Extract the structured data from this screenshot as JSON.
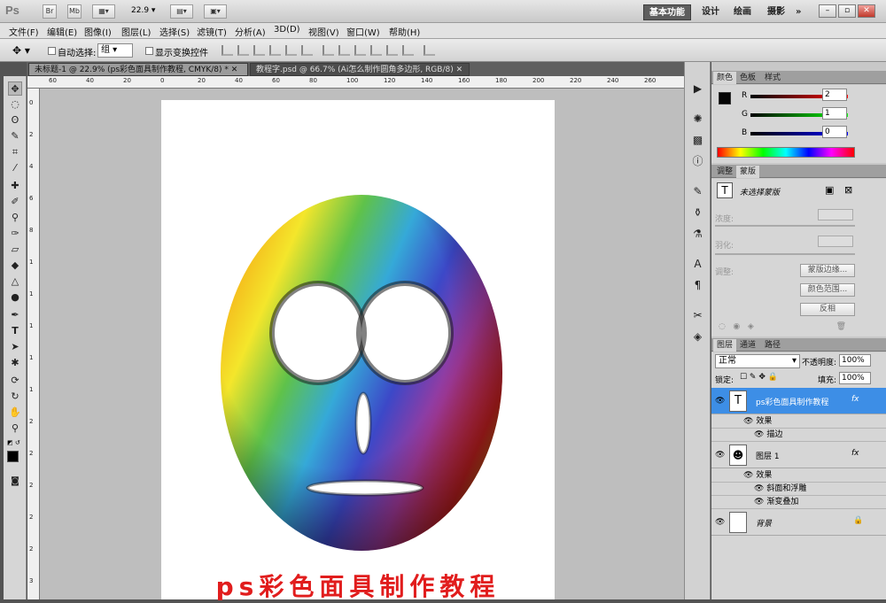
{
  "app": {
    "logo": "Ps",
    "zoom": "22.9",
    "br": "Br",
    "mb": "Mb"
  },
  "workspaces": [
    "基本功能",
    "设计",
    "绘画",
    "摄影",
    "»"
  ],
  "menus": [
    "文件(F)",
    "编辑(E)",
    "图像(I)",
    "图层(L)",
    "选择(S)",
    "滤镜(T)",
    "分析(A)",
    "3D(D)",
    "视图(V)",
    "窗口(W)",
    "帮助(H)"
  ],
  "options": {
    "auto_select": "自动选择:",
    "group_value": "组",
    "show_transform": "显示变换控件"
  },
  "tabs": [
    "未标题-1 @ 22.9% (ps彩色面具制作教程, CMYK/8) *",
    "教程字.psd @ 66.7% (Ai怎么制作圆角多边形, RGB/8)"
  ],
  "ruler": {
    "h": [
      "60",
      "40",
      "20",
      "0",
      "20",
      "40",
      "60",
      "80",
      "100",
      "120",
      "140",
      "160",
      "180",
      "200",
      "220",
      "240",
      "260"
    ],
    "v": [
      "0",
      "2",
      "4",
      "6",
      "8",
      "1",
      "1",
      "1",
      "1",
      "1",
      "2",
      "2",
      "2",
      "2",
      "2",
      "3"
    ]
  },
  "canvas": {
    "caption": "ps彩色面具制作教程"
  },
  "color_panel": {
    "tabs": [
      "颜色",
      "色板",
      "样式"
    ],
    "r_label": "R",
    "g_label": "G",
    "b_label": "B",
    "r": "2",
    "g": "1",
    "b": "0",
    "fg": "#050505",
    "bg": "#ffffff"
  },
  "mask_panel": {
    "tabs": [
      "调整",
      "蒙版"
    ],
    "no_mask": "未选择蒙版",
    "density": "浓度:",
    "feather": "羽化:",
    "refine": "调整:",
    "btn_edge": "蒙版边缘...",
    "btn_color": "颜色范围...",
    "btn_invert": "反相"
  },
  "layers_panel": {
    "tabs": [
      "图层",
      "通道",
      "路径"
    ],
    "blend": "正常",
    "opacity_label": "不透明度:",
    "opacity": "100%",
    "lock_label": "锁定:",
    "fill_label": "填充:",
    "fill": "100%",
    "layers": [
      {
        "name": "ps彩色面具制作教程",
        "fx": "fx",
        "effects_label": "效果",
        "effects": [
          "描边"
        ]
      },
      {
        "name": "图层 1",
        "fx": "fx",
        "effects_label": "效果",
        "effects": [
          "斜面和浮雕",
          "渐变叠加"
        ]
      },
      {
        "name": "背景"
      }
    ]
  }
}
